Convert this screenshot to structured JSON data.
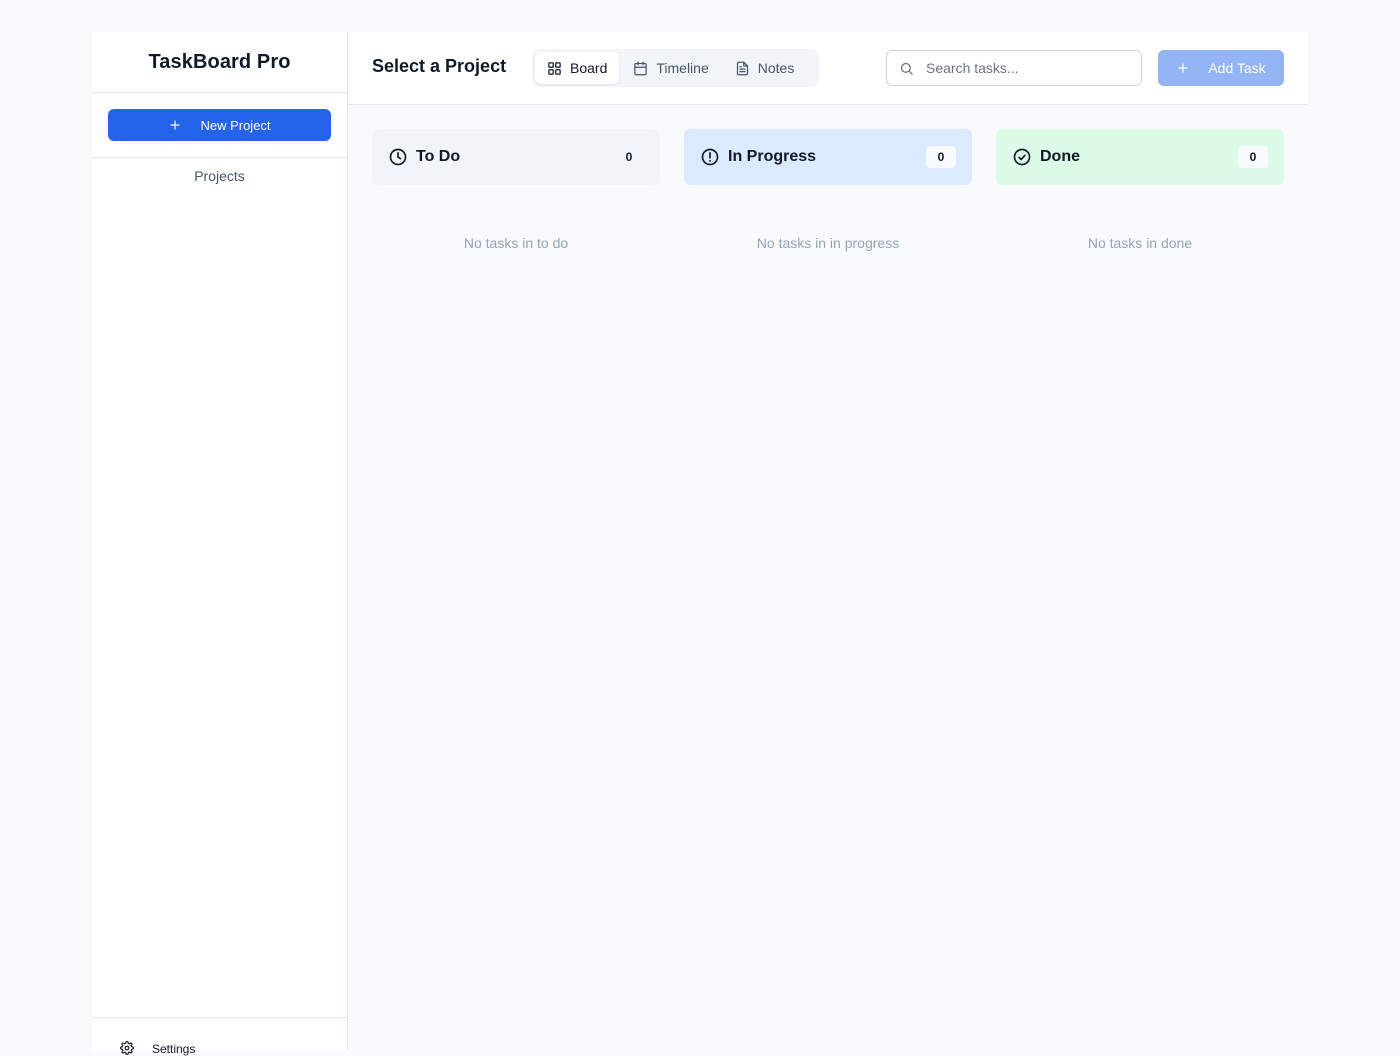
{
  "app": {
    "title": "TaskBoard Pro"
  },
  "sidebar": {
    "new_project_label": "New Project",
    "projects_label": "Projects",
    "settings_label": "Settings"
  },
  "header": {
    "title": "Select a Project",
    "tabs": [
      {
        "label": "Board",
        "icon": "grid-icon",
        "active": true
      },
      {
        "label": "Timeline",
        "icon": "calendar-icon",
        "active": false
      },
      {
        "label": "Notes",
        "icon": "document-icon",
        "active": false
      }
    ],
    "search": {
      "placeholder": "Search tasks...",
      "value": ""
    },
    "add_task_label": "Add Task"
  },
  "board": {
    "columns": [
      {
        "title": "To Do",
        "count": "0",
        "icon": "clock-icon",
        "empty_text": "No tasks in to do",
        "color": "#f1f5f9"
      },
      {
        "title": "In Progress",
        "count": "0",
        "icon": "alert-circle-icon",
        "empty_text": "No tasks in in progress",
        "color": "#dbeafe"
      },
      {
        "title": "Done",
        "count": "0",
        "icon": "check-circle-icon",
        "empty_text": "No tasks in done",
        "color": "#dcfce7"
      }
    ]
  },
  "colors": {
    "primary": "#2563eb",
    "primary_disabled": "#93b4f5",
    "background": "#f8fafc"
  }
}
